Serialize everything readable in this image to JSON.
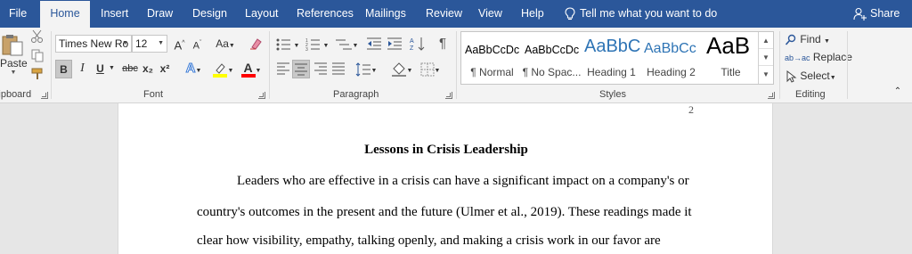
{
  "tabs": [
    "File",
    "Home",
    "Insert",
    "Draw",
    "Design",
    "Layout",
    "References",
    "Mailings",
    "Review",
    "View",
    "Help"
  ],
  "tell_me": "Tell me what you want to do",
  "share": "Share",
  "clipboard": {
    "paste": "Paste",
    "label": "Clipboard"
  },
  "font": {
    "name": "Times New Ro",
    "size": "12",
    "case": "Aa",
    "label": "Font",
    "bold": "B",
    "italic": "I",
    "underline": "U",
    "strike": "abc",
    "sub": "x₂",
    "sup": "x²",
    "grow": "A",
    "shrink": "A"
  },
  "paragraph": {
    "label": "Paragraph",
    "pilcrow": "¶"
  },
  "styles": {
    "label": "Styles",
    "items": [
      {
        "sample": "AaBbCcDc",
        "name": "¶ Normal"
      },
      {
        "sample": "AaBbCcDc",
        "name": "¶ No Spac..."
      },
      {
        "sample": "AaBbC",
        "name": "Heading 1"
      },
      {
        "sample": "AaBbCc",
        "name": "Heading 2"
      },
      {
        "sample": "AaB",
        "name": "Title"
      }
    ]
  },
  "editing": {
    "find": "Find",
    "replace": "Replace",
    "select": "Select",
    "label": "Editing"
  },
  "colors": {
    "accent": "#2b579a",
    "highlight": "#ffff00",
    "font_color": "#ff0000"
  },
  "document": {
    "page_number": "2",
    "title": "Lessons in Crisis Leadership",
    "lines": [
      "Leaders who are effective in a crisis can have a significant impact on a company's or",
      "country's outcomes in the present and the future (Ulmer et al., 2019). These readings made it",
      "clear how visibility, empathy, talking openly, and making a crisis work in our favor are"
    ]
  }
}
